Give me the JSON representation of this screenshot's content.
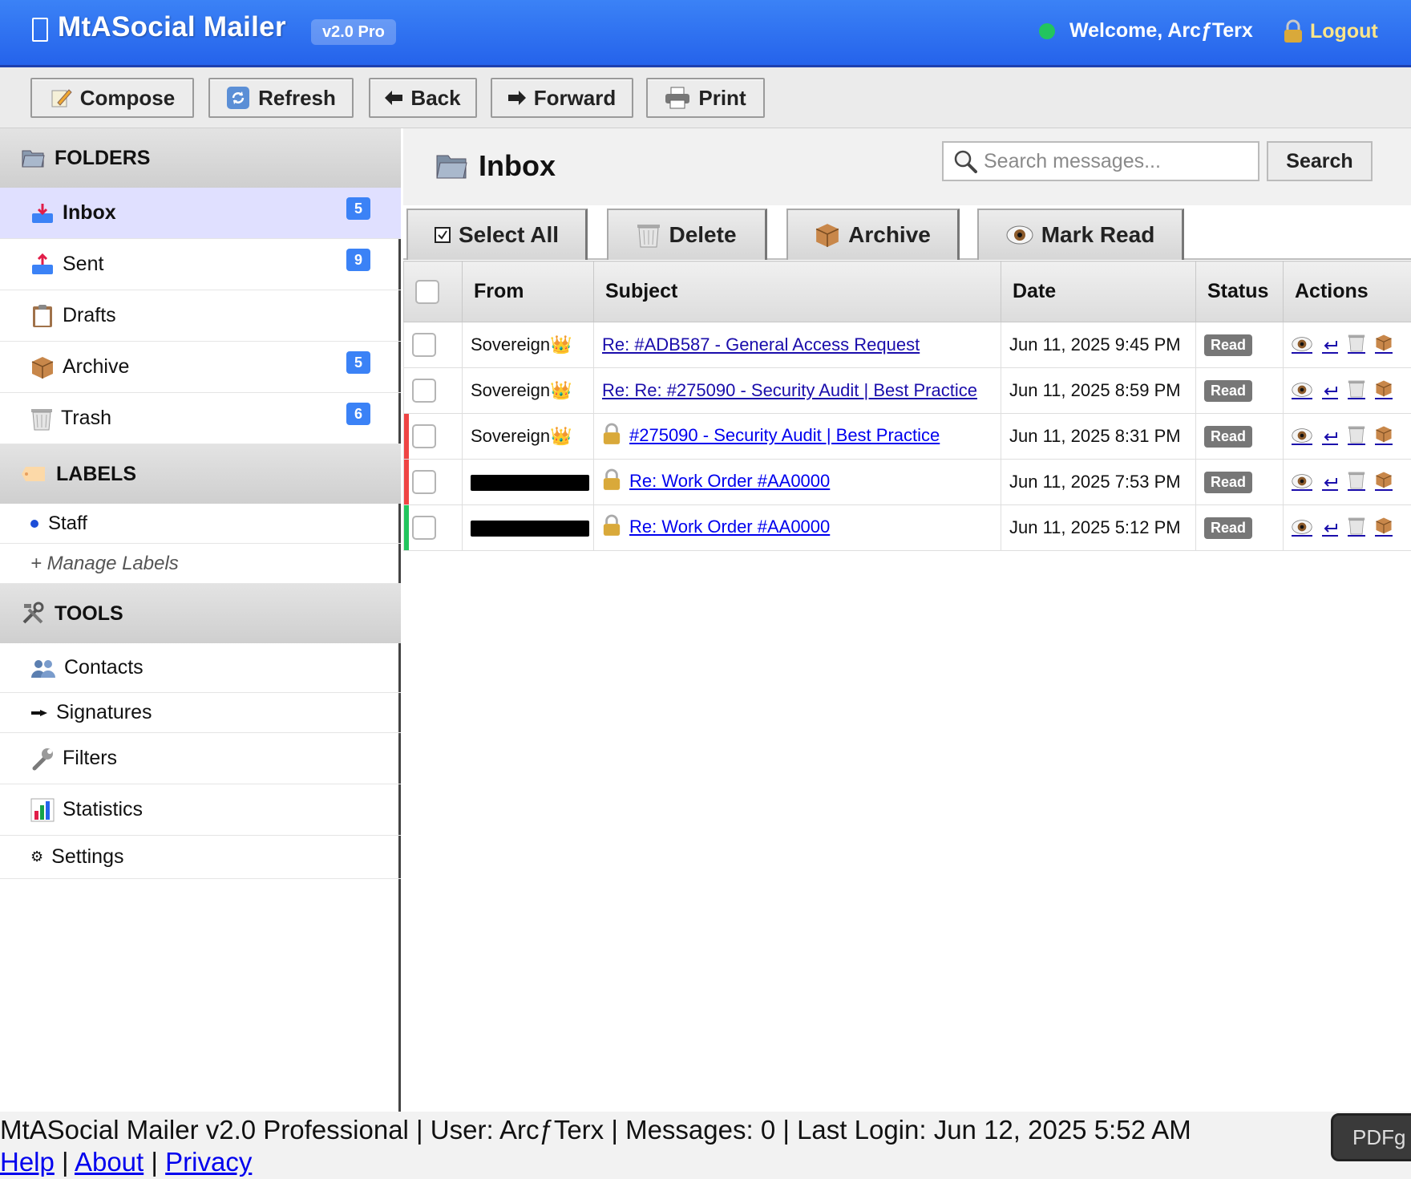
{
  "header": {
    "title": "MtASocial Mailer",
    "version": "v2.0 Pro",
    "welcome": "Welcome, ArcƒTerx",
    "logout": "Logout"
  },
  "toolbar": {
    "compose": "Compose",
    "refresh": "Refresh",
    "back": "Back",
    "forward": "Forward",
    "print": "Print"
  },
  "sidebar": {
    "folders_title": "FOLDERS",
    "folders": [
      {
        "label": "Inbox",
        "count": "5",
        "icon": "inbox-icon"
      },
      {
        "label": "Sent",
        "count": "9",
        "icon": "outbox-icon"
      },
      {
        "label": "Drafts",
        "count": "",
        "icon": "clipboard-icon"
      },
      {
        "label": "Archive",
        "count": "5",
        "icon": "package-icon"
      },
      {
        "label": "Trash",
        "count": "6",
        "icon": "trash-icon"
      }
    ],
    "labels_title": "LABELS",
    "labels": [
      {
        "label": "Staff",
        "color": "#1d4ed8"
      }
    ],
    "manage_labels": "+ Manage Labels",
    "tools_title": "TOOLS",
    "tools": [
      {
        "label": "Contacts",
        "icon": "contacts-icon"
      },
      {
        "label": "Signatures",
        "icon": "pen-icon"
      },
      {
        "label": "Filters",
        "icon": "wrench-icon"
      },
      {
        "label": "Statistics",
        "icon": "bar-chart-icon"
      },
      {
        "label": "Settings",
        "icon": "gear-icon"
      }
    ]
  },
  "main": {
    "folder_title": "Inbox",
    "search_placeholder": "Search messages...",
    "search_button": "Search",
    "actions": {
      "select_all": "Select All",
      "delete": "Delete",
      "archive": "Archive",
      "mark_read": "Mark Read"
    },
    "columns": [
      "From",
      "Subject",
      "Date",
      "Status",
      "Actions"
    ],
    "messages": [
      {
        "from": "Sovereign👑",
        "subject": "Re: #ADB587 - General Access Request",
        "date": "Jun 11, 2025 9:45 PM",
        "status": "Read",
        "locked": false
      },
      {
        "from": "Sovereign👑",
        "subject": "Re: Re: #275090 - Security Audit | Best Practice",
        "date": "Jun 11, 2025 8:59 PM",
        "status": "Read",
        "locked": false
      },
      {
        "from": "Sovereign👑",
        "subject": "#275090 - Security Audit | Best Practice",
        "date": "Jun 11, 2025 8:31 PM",
        "status": "Read",
        "locked": true
      },
      {
        "from": "",
        "subject": "Re: Work Order #AA0000",
        "date": "Jun 11, 2025 7:53 PM",
        "status": "Read",
        "locked": true
      },
      {
        "from": "",
        "subject": "Re: Work Order #AA0000",
        "date": "Jun 11, 2025 5:12 PM",
        "status": "Read",
        "locked": true
      }
    ]
  },
  "footer": {
    "info": "MtASocial Mailer v2.0 Professional | User: ArcƒTerx | Messages: 0 | Last Login: Jun 12, 2025 5:52 AM",
    "links": [
      "Help",
      "About",
      "Privacy"
    ],
    "pdf_tooltip": "PDFg"
  },
  "colors": {
    "header_blue": "#2563eb",
    "badge_blue": "#3b82f6",
    "status_green": "#22c55e",
    "flag_red": "#ef4444",
    "flag_green": "#22c55e",
    "link": "#1a0dab"
  }
}
